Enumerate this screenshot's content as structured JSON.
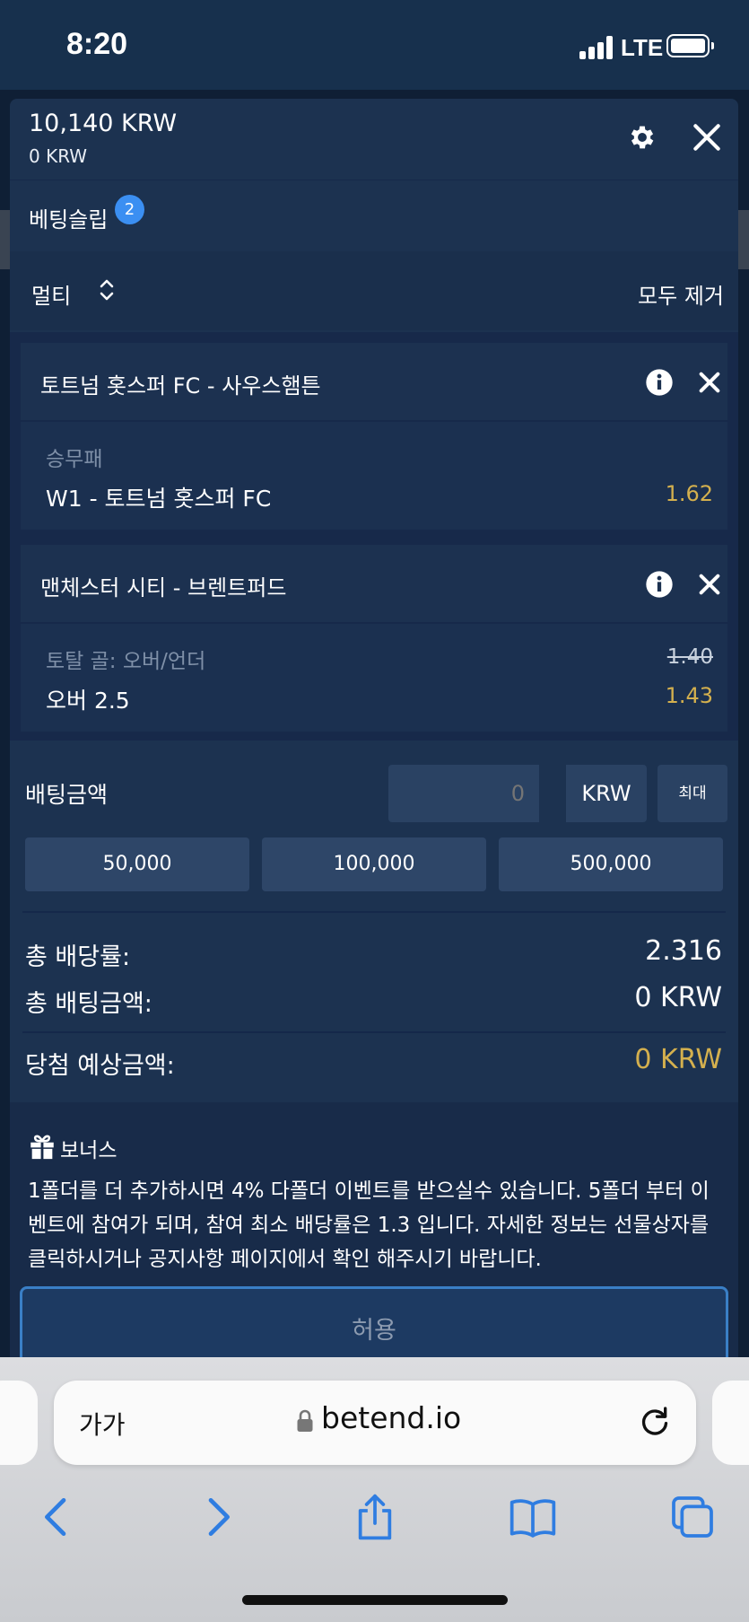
{
  "status_bar": {
    "time": "8:20",
    "network": "LTE"
  },
  "header": {
    "balance": "10,140 KRW",
    "bonus_balance": "0 KRW"
  },
  "slip": {
    "title": "베팅슬립",
    "count": "2",
    "mode": "멀티",
    "clear_all": "모두 제거"
  },
  "bets": [
    {
      "match": "토트넘 홋스퍼 FC - 사우스햄튼",
      "market": "승무패",
      "pick": "W1 - 토트넘 홋스퍼 FC",
      "old_odds": "",
      "odds": "1.62"
    },
    {
      "match": "맨체스터 시티 - 브렌트퍼드",
      "market": "토탈 골: 오버/언더",
      "pick": "오버 2.5",
      "old_odds": "1.40",
      "odds": "1.43"
    }
  ],
  "stake": {
    "label": "배팅금액",
    "placeholder": "0",
    "currency": "KRW",
    "max_label": "최대",
    "quick_amounts": [
      "50,000",
      "100,000",
      "500,000"
    ]
  },
  "summary": {
    "total_odds_label": "총 배당률:",
    "total_odds": "2.316",
    "total_stake_label": "총 배팅금액:",
    "total_stake": "0 KRW",
    "potential_win_label": "당첨 예상금액:",
    "potential_win": "0 KRW"
  },
  "bonus": {
    "title": "보너스",
    "text": "1폴더를 더 추가하시면 4% 다폴더 이벤트를 받으실수 있습니다. 5폴더 부터 이벤트에 참여가 되며, 참여 최소 배당률은 1.3 입니다. 자세한 정보는 선물상자를 클릭하시거나 공지사항 페이지에서 확인 해주시기 바랍니다."
  },
  "accept_button": "허용",
  "browser": {
    "text_size_label": "가가",
    "url": "betend.io"
  },
  "colors": {
    "accent": "#3b8ff2",
    "odds": "#d4b04e",
    "panel": "#1c3250"
  },
  "icons": [
    "gear-icon",
    "close-icon",
    "chevron-updown-icon",
    "info-icon",
    "remove-icon",
    "gift-icon",
    "lock-icon",
    "reload-icon",
    "back-icon",
    "forward-icon",
    "share-icon",
    "bookmarks-icon",
    "tabs-icon"
  ]
}
